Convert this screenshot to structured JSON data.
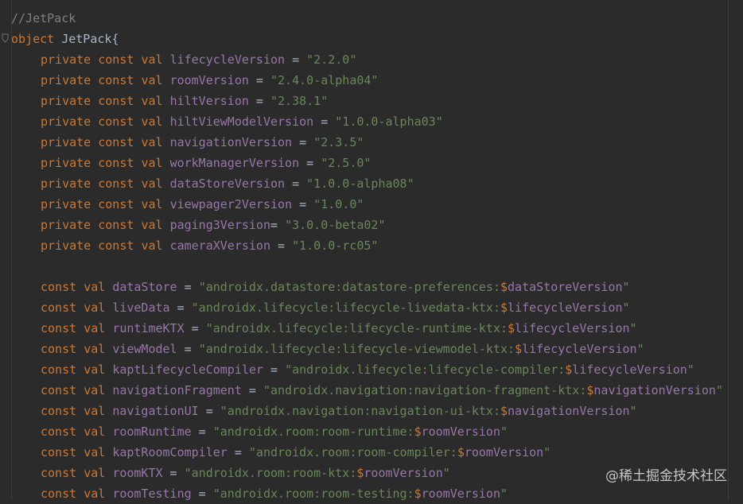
{
  "comment": "//JetPack",
  "object_keyword": "object",
  "object_name": "JetPack{",
  "private_kw": "private",
  "const_kw": "const",
  "val_kw": "val",
  "private_vals": [
    {
      "name": "lifecycleVersion",
      "op": " = ",
      "value": "\"2.2.0\""
    },
    {
      "name": "roomVersion",
      "op": " = ",
      "value": "\"2.4.0-alpha04\""
    },
    {
      "name": "hiltVersion",
      "op": " = ",
      "value": "\"2.38.1\""
    },
    {
      "name": "hiltViewModelVersion",
      "op": " = ",
      "value": "\"1.0.0-alpha03\""
    },
    {
      "name": "navigationVersion",
      "op": " = ",
      "value": "\"2.3.5\""
    },
    {
      "name": "workManagerVersion",
      "op": " = ",
      "value": "\"2.5.0\""
    },
    {
      "name": "dataStoreVersion",
      "op": " = ",
      "value": "\"1.0.0-alpha08\""
    },
    {
      "name": "viewpager2Version",
      "op": " = ",
      "value": "\"1.0.0\""
    },
    {
      "name": "paging3Version",
      "op": "= ",
      "value": "\"3.0.0-beta02\""
    },
    {
      "name": "cameraXVersion",
      "op": " = ",
      "value": "\"1.0.0-rc05\""
    }
  ],
  "deps": [
    {
      "name": "dataStore",
      "str": "\"androidx.datastore:datastore-preferences:",
      "var": "dataStoreVersion"
    },
    {
      "name": "liveData",
      "str": "\"androidx.lifecycle:lifecycle-livedata-ktx:",
      "var": "lifecycleVersion"
    },
    {
      "name": "runtimeKTX",
      "str": "\"androidx.lifecycle:lifecycle-runtime-ktx:",
      "var": "lifecycleVersion"
    },
    {
      "name": "viewModel",
      "str": "\"androidx.lifecycle:lifecycle-viewmodel-ktx:",
      "var": "lifecycleVersion"
    },
    {
      "name": "kaptLifecycleCompiler",
      "str": "\"androidx.lifecycle:lifecycle-compiler:",
      "var": "lifecycleVersion"
    },
    {
      "name": "navigationFragment",
      "str": "\"androidx.navigation:navigation-fragment-ktx:",
      "var": "navigationVersion"
    },
    {
      "name": "navigationUI",
      "str": "\"androidx.navigation:navigation-ui-ktx:",
      "var": "navigationVersion"
    },
    {
      "name": "roomRuntime",
      "str": "\"androidx.room:room-runtime:",
      "var": "roomVersion"
    },
    {
      "name": "kaptRoomCompiler",
      "str": "\"androidx.room:room-compiler:",
      "var": "roomVersion"
    },
    {
      "name": "roomKTX",
      "str": "\"androidx.room:room-ktx:",
      "var": "roomVersion"
    },
    {
      "name": "roomTesting",
      "str": "\"androidx.room:room-testing:",
      "var": "roomVersion"
    }
  ],
  "dollar": "$",
  "close_quote": "\"",
  "watermark": "@稀土掘金技术社区",
  "colors": {
    "background": "#2b2b2b",
    "keyword": "#cc7832",
    "identifier": "#a9b7c6",
    "property": "#9876aa",
    "string": "#6a8759",
    "comment": "#808080"
  }
}
